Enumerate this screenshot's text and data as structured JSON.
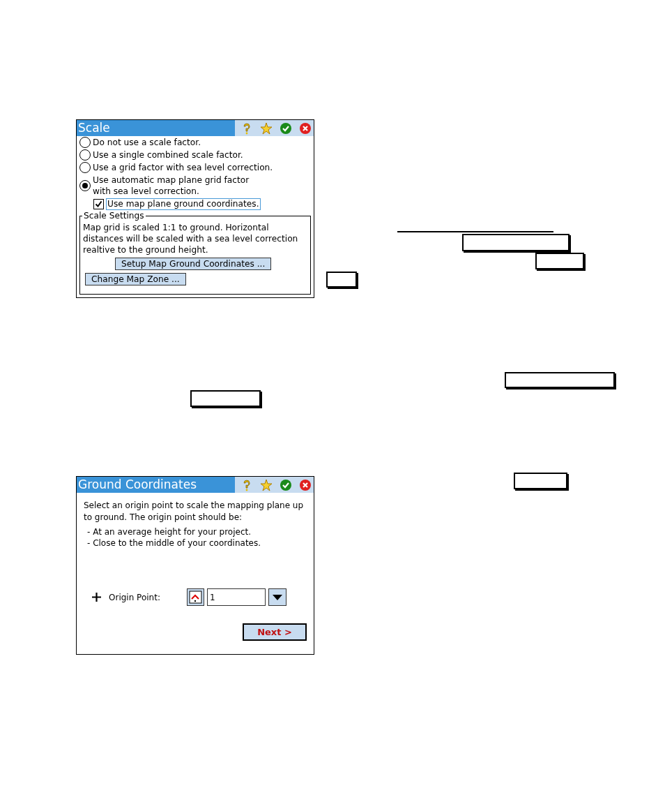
{
  "scale_dialog": {
    "title": "Scale",
    "options": [
      {
        "label": "Do not use a scale factor.",
        "selected": false
      },
      {
        "label": "Use a single combined scale factor.",
        "selected": false
      },
      {
        "label": "Use a grid factor with sea level correction.",
        "selected": false
      },
      {
        "label": "Use automatic map plane grid factor\nwith sea level correction.",
        "selected": true
      }
    ],
    "ground_checkbox": {
      "label": "Use map plane ground coordinates.",
      "checked": true
    },
    "group": {
      "title": "Scale Settings",
      "text": "Map grid is scaled 1:1 to ground. Horizontal distances will be scaled with a sea level correction realtive to the ground height.",
      "buttons": [
        "Setup Map Ground Coordinates ...",
        "Change Map Zone ..."
      ]
    }
  },
  "ground_dialog": {
    "title": "Ground Coordinates",
    "intro": "Select an origin point to scale the mapping plane up to ground. The origin point should be:",
    "bullets": [
      "- At an average height for your project.",
      "- Close to the middle of your coordinates."
    ],
    "origin_label": "Origin Point:",
    "origin_value": "1",
    "next_button": "Next >"
  }
}
